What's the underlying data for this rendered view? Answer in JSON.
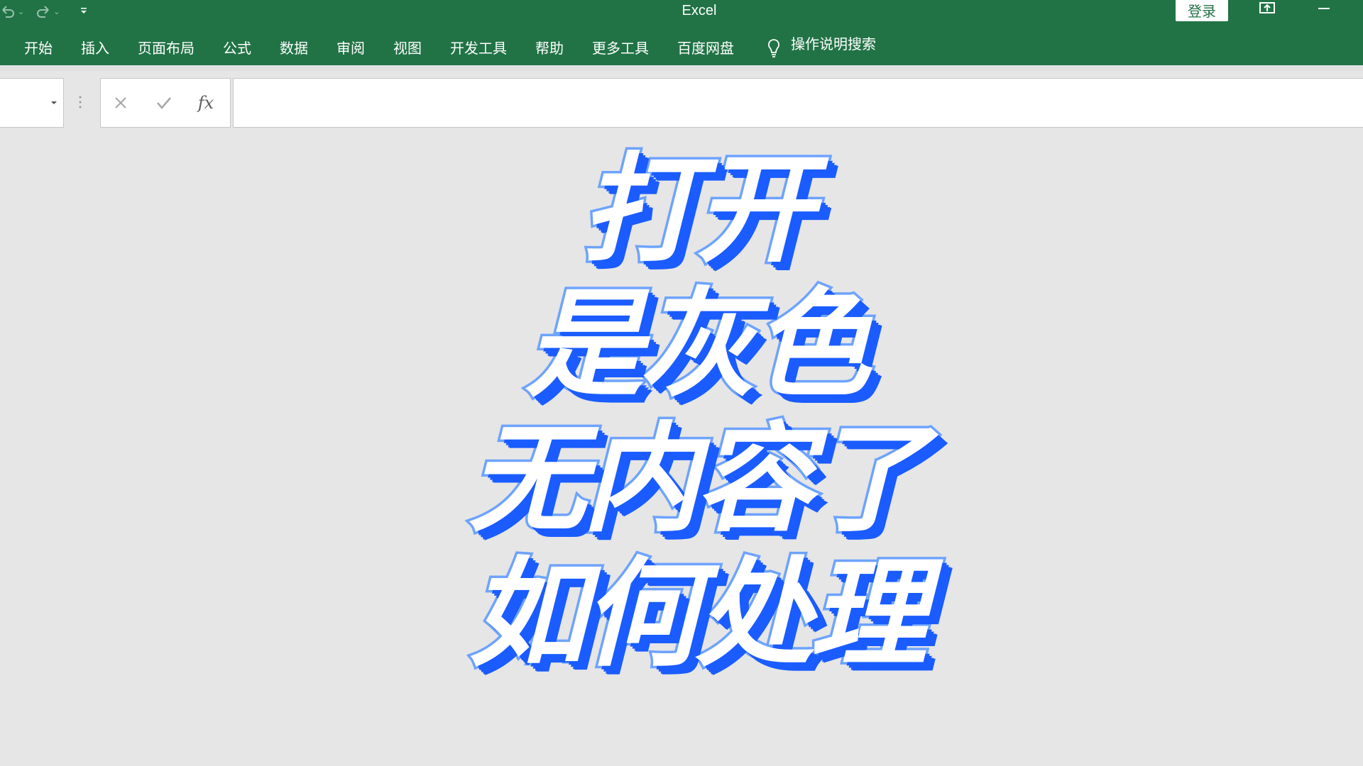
{
  "titlebar": {
    "app_title": "Excel",
    "signin_label": "登录",
    "undo_icon": "undo-icon",
    "redo_icon": "redo-icon",
    "customize_icon": "customize-quick-access-icon",
    "ribbon_display_icon": "ribbon-display-options-icon",
    "minimize_icon": "minimize-icon"
  },
  "tabs": [
    {
      "label": "开始"
    },
    {
      "label": "插入"
    },
    {
      "label": "页面布局"
    },
    {
      "label": "公式"
    },
    {
      "label": "数据"
    },
    {
      "label": "审阅"
    },
    {
      "label": "视图"
    },
    {
      "label": "开发工具"
    },
    {
      "label": "帮助"
    },
    {
      "label": "更多工具"
    },
    {
      "label": "百度网盘"
    }
  ],
  "tellme": {
    "label": "操作说明搜索",
    "icon": "lightbulb-icon"
  },
  "formulabar": {
    "namebox_value": "",
    "cancel_icon": "cancel-icon",
    "enter_icon": "checkmark-icon",
    "fx_label": "fx",
    "formula_value": ""
  },
  "overlay": {
    "line1": "打开",
    "line2": "是灰色",
    "line3": "无内容了",
    "line4": "如何处理"
  },
  "colors": {
    "ribbon_green": "#217346",
    "workspace_gray": "#e6e6e6",
    "caption_outline": "#6ea3ff",
    "caption_shadow": "#1a5cff"
  }
}
